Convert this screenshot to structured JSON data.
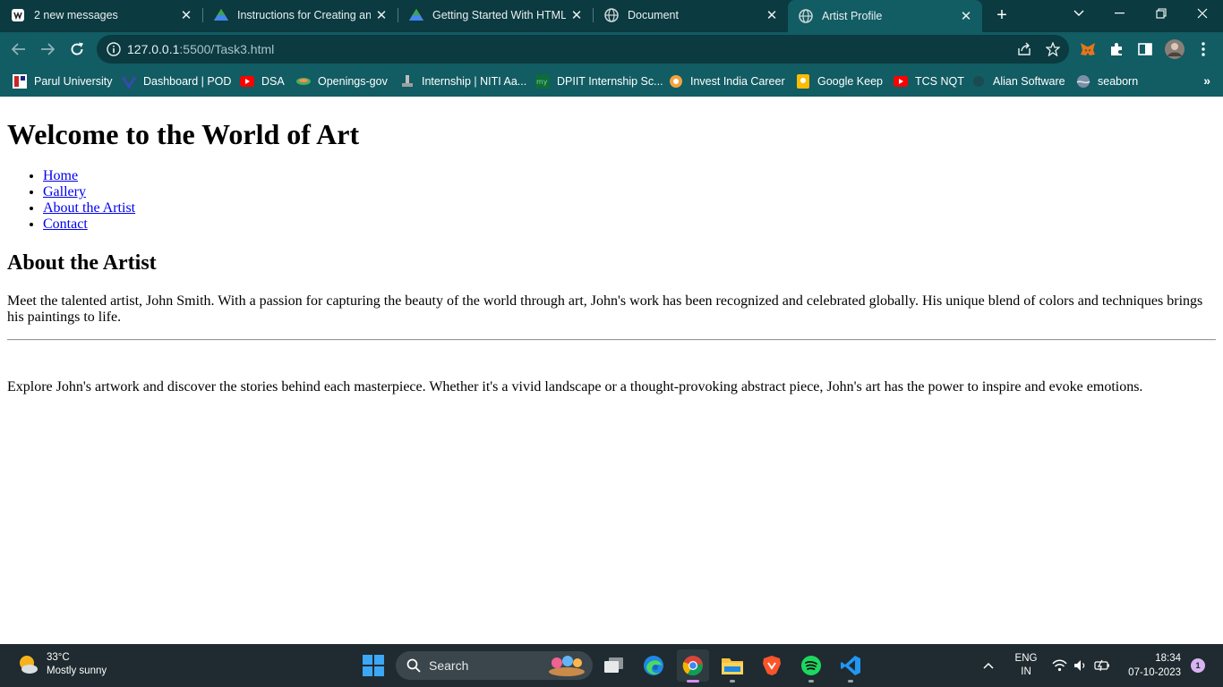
{
  "browser": {
    "tabs": [
      {
        "title": "2 new messages",
        "icon": "mail-icon"
      },
      {
        "title": "Instructions for Creating and",
        "icon": "google-drive-icon"
      },
      {
        "title": "Getting Started With HTML.p",
        "icon": "google-drive-icon"
      },
      {
        "title": "Document",
        "icon": "globe-icon"
      },
      {
        "title": "Artist Profile",
        "icon": "globe-icon",
        "active": true
      }
    ],
    "url_host": "127.0.0.1",
    "url_rest": ":5500/Task3.html",
    "bookmarks": [
      {
        "label": "Parul University",
        "icon": "parul-logo-icon"
      },
      {
        "label": "Dashboard | POD",
        "icon": "pod-logo-icon"
      },
      {
        "label": "DSA",
        "icon": "youtube-icon"
      },
      {
        "label": "Openings-gov",
        "icon": "gov-logo-icon"
      },
      {
        "label": "Internship | NITI Aa...",
        "icon": "niti-logo-icon"
      },
      {
        "label": "DPIIT Internship Sc...",
        "icon": "mygov-logo-icon"
      },
      {
        "label": "Invest India Career",
        "icon": "invest-india-icon"
      },
      {
        "label": "Google Keep",
        "icon": "google-keep-icon"
      },
      {
        "label": "TCS NQT",
        "icon": "youtube-icon"
      },
      {
        "label": "Alian Software",
        "icon": "alian-logo-icon"
      },
      {
        "label": "seaborn",
        "icon": "seaborn-logo-icon"
      }
    ]
  },
  "page": {
    "heading": "Welcome to the World of Art",
    "nav": [
      "Home",
      "Gallery",
      "About the Artist",
      "Contact"
    ],
    "section_heading": "About the Artist",
    "paragraph1": "Meet the talented artist, John Smith. With a passion for capturing the beauty of the world through art, John's work has been recognized and celebrated globally. His unique blend of colors and techniques brings his paintings to life.",
    "paragraph2": "Explore John's artwork and discover the stories behind each masterpiece. Whether it's a vivid landscape or a thought-provoking abstract piece, John's art has the power to inspire and evoke emotions."
  },
  "taskbar": {
    "weather_temp": "33°C",
    "weather_desc": "Mostly sunny",
    "search_label": "Search",
    "lang_top": "ENG",
    "lang_bottom": "IN",
    "time": "18:34",
    "date": "07-10-2023",
    "notification_count": "1"
  },
  "colors": {
    "tab_strip": "#0b3a40",
    "toolbar": "#125c63",
    "link": "#0000ee",
    "taskbar": "#1f2b30"
  }
}
